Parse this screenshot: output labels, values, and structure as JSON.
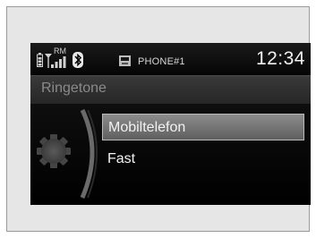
{
  "status_bar": {
    "battery_icon": "battery-icon",
    "signal_icon": "signal-strength-icon",
    "roaming_label": "RM",
    "bluetooth_icon": "bluetooth-icon",
    "phone_icon": "phone-memory-icon",
    "phone_name": "PHONE#1",
    "clock": "12:34"
  },
  "header": {
    "title": "Ringetone"
  },
  "menu": {
    "knob_icon": "dial-knob-icon",
    "items": [
      {
        "label": "Mobiltelefon",
        "selected": true
      },
      {
        "label": "Fast",
        "selected": false
      }
    ]
  },
  "colors": {
    "screen_bg": "#000000",
    "highlight": "#7a7a7a"
  }
}
